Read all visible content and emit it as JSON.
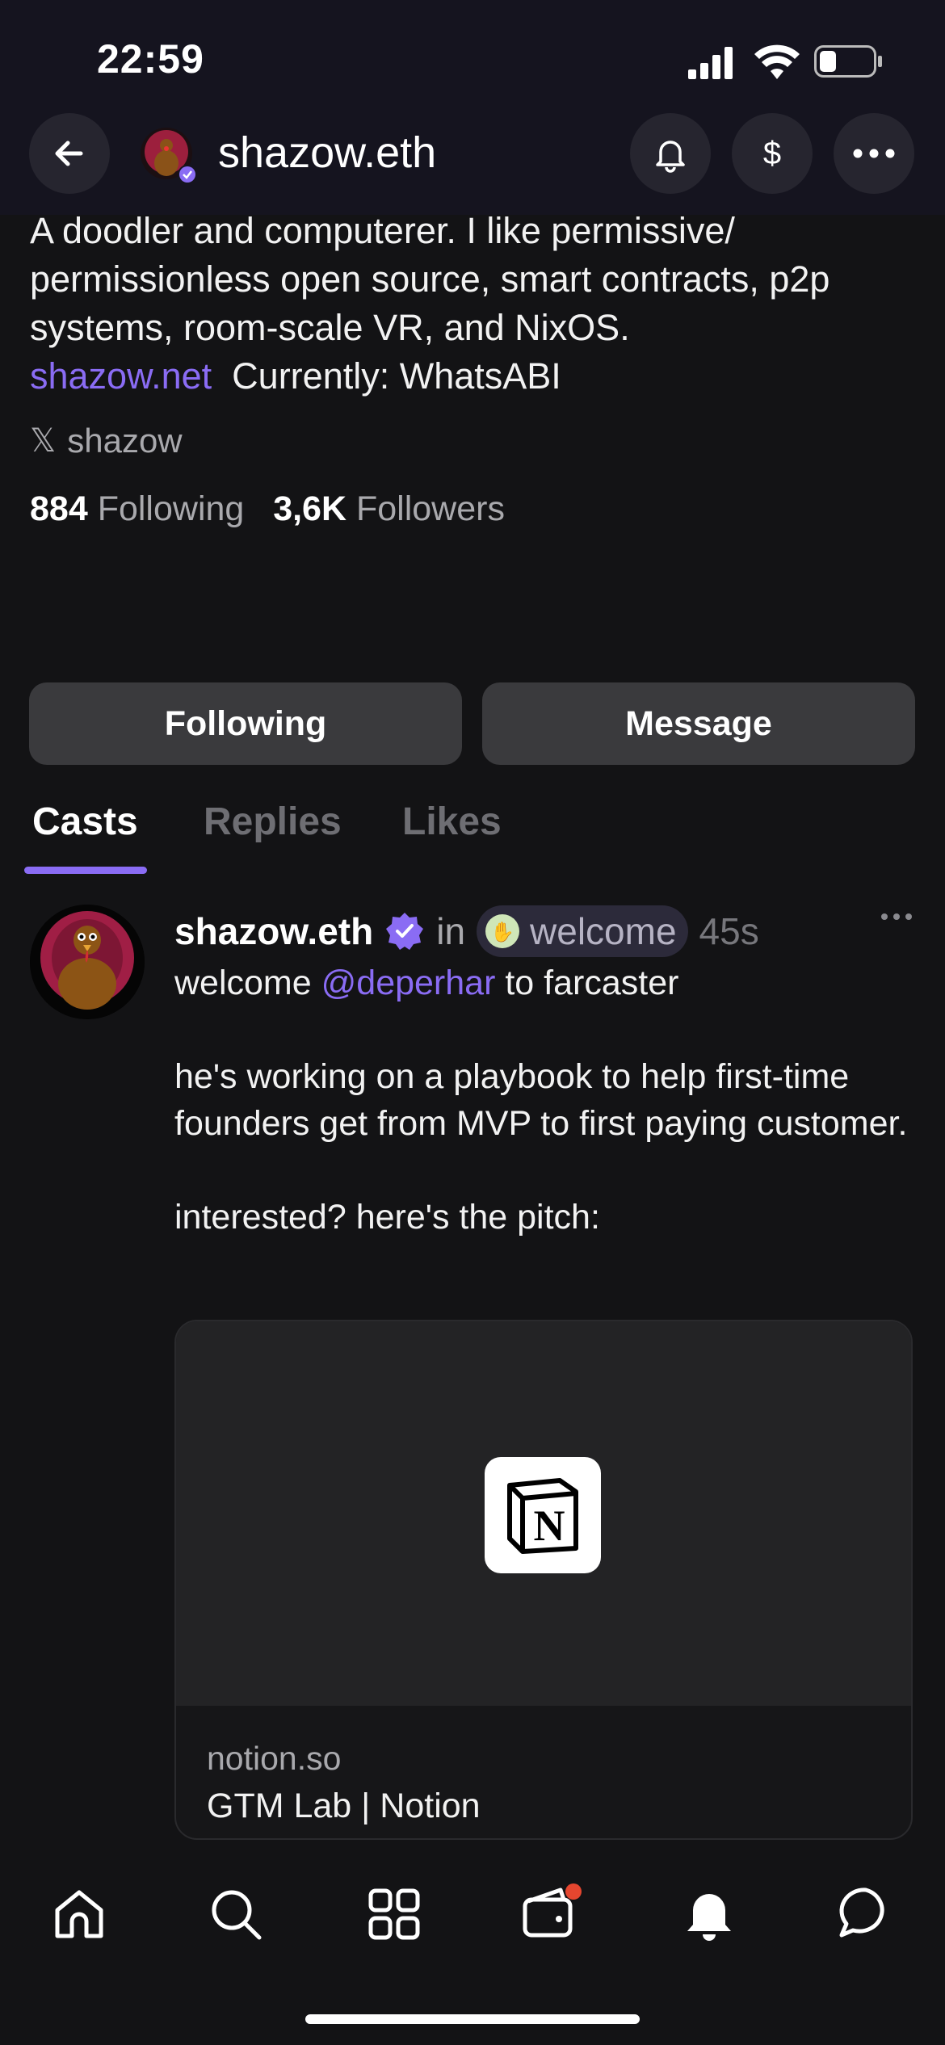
{
  "status_bar": {
    "time": "22:59"
  },
  "header": {
    "title": "shazow.eth"
  },
  "profile": {
    "bio_text": "A doodler and computerer. I like permissive/ permissionless open source, smart contracts, p2p systems, room-scale VR, and NixOS.",
    "bio_link": "shazow.net",
    "bio_current": "Currently: WhatsABI",
    "x_handle": "shazow",
    "following_count": "884",
    "following_label": "Following",
    "followers_count": "3,6K",
    "followers_label": "Followers"
  },
  "actions": {
    "following_label": "Following",
    "message_label": "Message"
  },
  "tabs": [
    {
      "label": "Casts",
      "active": true
    },
    {
      "label": "Replies",
      "active": false
    },
    {
      "label": "Likes",
      "active": false
    }
  ],
  "post": {
    "author": "shazow.eth",
    "in_label": "in",
    "channel": "welcome",
    "time": "45s",
    "line1_prefix": "welcome ",
    "mention": "@deperhar",
    "line1_suffix": " to farcaster",
    "paragraph2": "he's working on a playbook to help first-time founders get from MVP to first paying customer.",
    "paragraph3": "interested? here's the pitch:",
    "card": {
      "domain": "notion.so",
      "title": "GTM Lab | Notion"
    }
  },
  "bottom_nav": [
    "home-icon",
    "search-icon",
    "grid-icon",
    "wallet-icon",
    "notifications-icon",
    "chat-icon"
  ],
  "colors": {
    "accent": "#8a6cf4",
    "background": "#131315",
    "header": "#15141f",
    "badge": "#e5462f"
  }
}
